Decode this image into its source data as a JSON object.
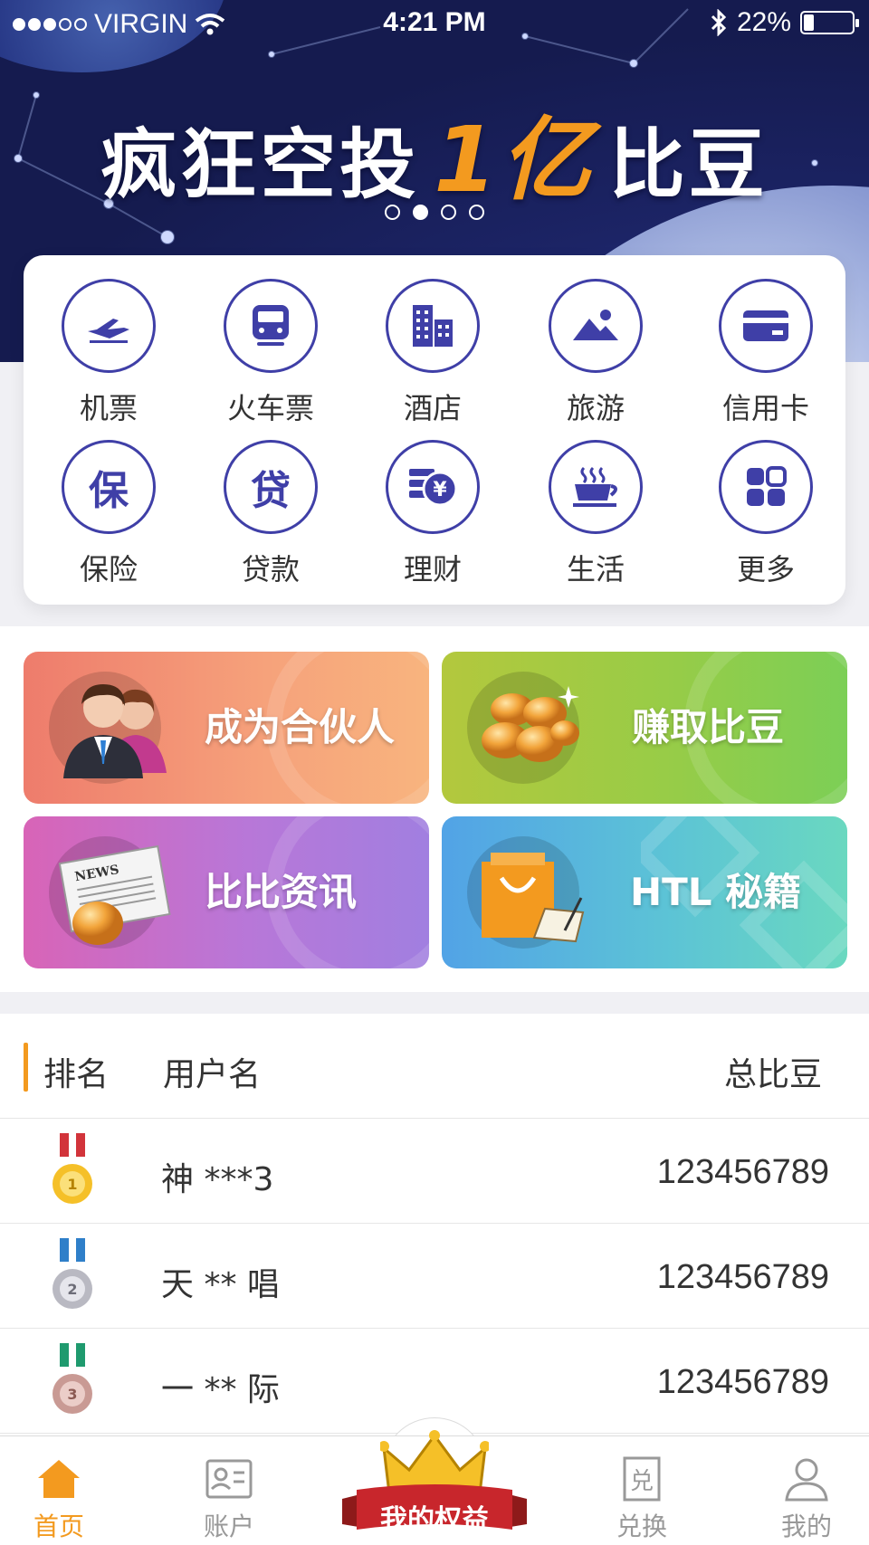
{
  "status_bar": {
    "carrier": "VIRGIN",
    "time": "4:21 PM",
    "battery": "22%",
    "battery_level": 0.22
  },
  "banner": {
    "headline_before": "疯狂空投",
    "headline_accent": "1亿",
    "headline_after": "比豆",
    "page_count": 4,
    "active_page": 2
  },
  "services": [
    {
      "label": "机票",
      "icon": "plane-icon"
    },
    {
      "label": "火车票",
      "icon": "train-icon"
    },
    {
      "label": "酒店",
      "icon": "hotel-icon"
    },
    {
      "label": "旅游",
      "icon": "landscape-icon"
    },
    {
      "label": "信用卡",
      "icon": "credit-card-icon"
    },
    {
      "label": "保险",
      "icon": "insurance-icon",
      "glyph": "保"
    },
    {
      "label": "贷款",
      "icon": "loan-icon",
      "glyph": "贷"
    },
    {
      "label": "理财",
      "icon": "finance-icon"
    },
    {
      "label": "生活",
      "icon": "coffee-icon"
    },
    {
      "label": "更多",
      "icon": "more-icon"
    }
  ],
  "tiles": {
    "partner": "成为合伙人",
    "earn": "赚取比豆",
    "news": "比比资讯",
    "htl": "HTL 秘籍"
  },
  "ranking": {
    "headers": {
      "rank": "排名",
      "user": "用户名",
      "total": "总比豆"
    },
    "rows": [
      {
        "rank": 1,
        "user": "神 ***3",
        "total": "123456789"
      },
      {
        "rank": 2,
        "user": "天 ** 唱",
        "total": "123456789"
      },
      {
        "rank": 3,
        "user": "一 ** 际",
        "total": "123456789"
      }
    ]
  },
  "tabbar": {
    "home": "首页",
    "account": "账户",
    "benefits": "我的权益",
    "exchange": "兑换",
    "mine": "我的",
    "exchange_glyph": "兑"
  },
  "colors": {
    "accent": "#f39a1f",
    "primary": "#3f3fa7"
  }
}
